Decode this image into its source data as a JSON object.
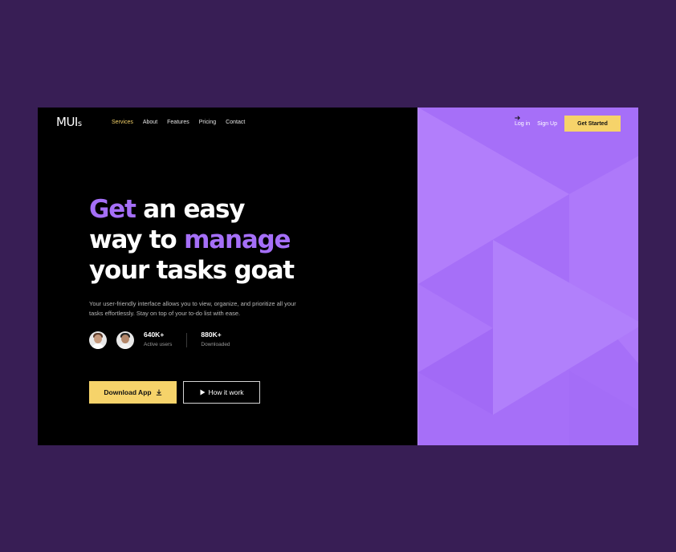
{
  "brand": {
    "logo": "MUI",
    "logo_suffix": "s"
  },
  "nav": {
    "items": [
      {
        "label": "Services"
      },
      {
        "label": "About"
      },
      {
        "label": "Features"
      },
      {
        "label": "Pricing"
      },
      {
        "label": "Contact"
      }
    ]
  },
  "auth": {
    "login": "Log in",
    "signup": "Sign Up",
    "cta": "Get Started"
  },
  "hero": {
    "line1_highlight": "Get",
    "line1_rest": "an easy",
    "line2_start": "way to",
    "line2_highlight": "manage",
    "line3": "your tasks goat",
    "description": "Your user-friendly interface allows you to view, organize, and prioritize all your tasks effortlessly. Stay on top of your to-do list with ease."
  },
  "stats": [
    {
      "value": "640K+",
      "label": "Active users"
    },
    {
      "value": "880K+",
      "label": "Downloaded"
    }
  ],
  "buttons": {
    "download": "Download App",
    "how": "How it work"
  },
  "colors": {
    "background": "#381e55",
    "accent_purple": "#a56ff8",
    "accent_yellow": "#f6d36a"
  }
}
